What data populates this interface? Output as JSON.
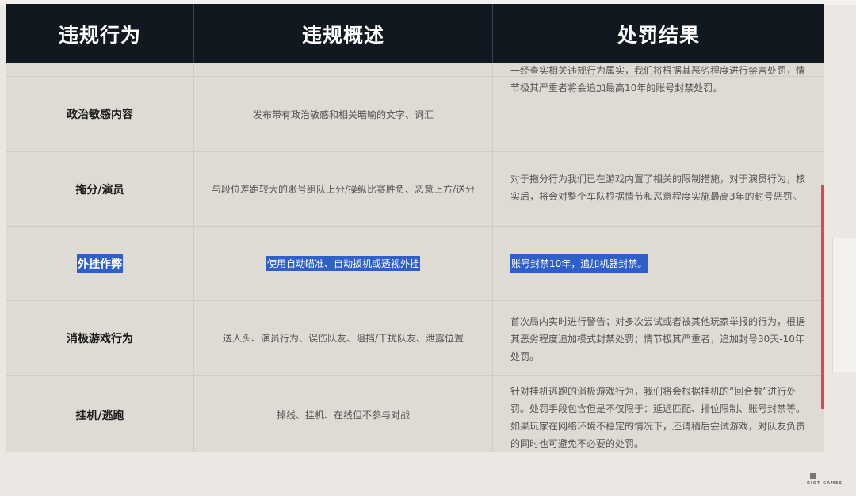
{
  "header": {
    "col1": "违规行为",
    "col2": "违规概述",
    "col3": "处罚结果"
  },
  "rows": [
    {
      "behavior": "政治敏感内容",
      "summary": "发布带有政治敏感和相关暗喻的文字、词汇",
      "result": [
        "一经查实相关违规行为属实，我们将根据其恶劣程度进行禁言处罚，情",
        "节极其严重者将会追加最高10年的账号封禁处罚。"
      ]
    },
    {
      "behavior": "拖分/演员",
      "summary": "与段位差距较大的账号组队上分/操纵比赛胜负、恶意上方/送分",
      "result": [
        "对于拖分行为我们已在游戏内置了相关的限制措施，对于演员行为，核",
        "实后，将会对整个车队根据情节和恶意程度实施最高3年的封号惩罚。"
      ]
    },
    {
      "behavior": "外挂作弊",
      "summary": "使用自动瞄准、自动扳机或透视外挂",
      "result": [
        "账号封禁10年，追加机器封禁。"
      ],
      "selected": true
    },
    {
      "behavior": "消极游戏行为",
      "summary": "送人头、演员行为、误伤队友、阻挡/干扰队友、泄露位置",
      "result": [
        "首次局内实时进行警告；对多次尝试或者被其他玩家举报的行为，根据",
        "其恶劣程度追加模式封禁处罚；情节极其严重者，追加封号30天-10年",
        "处罚。"
      ]
    },
    {
      "behavior": "挂机/逃跑",
      "summary": "掉线、挂机、在线但不参与对战",
      "result": [
        "针对挂机逃跑的消极游戏行为，我们将会根据挂机的“回合数”进行处",
        "罚。处罚手段包含但是不仅限于：延迟匹配、排位限制、账号封禁等。",
        "如果玩家在网络环境不稳定的情况下，还请稍后尝试游戏，对队友负责",
        "的同时也可避免不必要的处罚。"
      ]
    }
  ],
  "footer": {
    "logo_text": "RIOT GAMES"
  },
  "colors": {
    "header_bg": "#111820",
    "table_bg": "#dedad4",
    "selection": "#2f5fc8",
    "scroll_accent": "#e8424e"
  }
}
